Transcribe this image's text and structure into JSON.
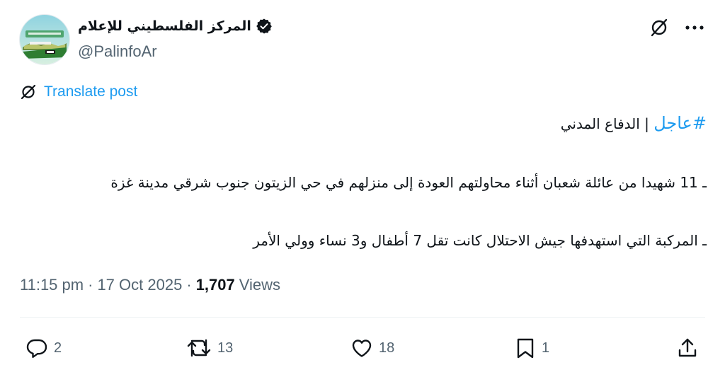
{
  "author": {
    "display_name": "المركز الفلسطيني للإعلام",
    "handle": "@PalinfoAr",
    "verified": true
  },
  "translate": {
    "label": "Translate post"
  },
  "post": {
    "hashtag": "#عاجل",
    "headline_rest": " | الدفاع المدني",
    "line2": "ـ 11 شهيدا من عائلة شعبان أثناء محاولتهم العودة إلى منزلهم في حي الزيتون جنوب شرقي مدينة غزة",
    "line3": "ـ المركبة التي استهدفها جيش الاحتلال كانت تقل 7 أطفال و3 نساء وولي الأمر"
  },
  "meta": {
    "time": "11:15 pm",
    "separator": "·",
    "date": "17 Oct 2025",
    "views_count": "1,707",
    "views_label": "Views"
  },
  "actions": {
    "replies": "2",
    "reposts": "13",
    "likes": "18",
    "bookmarks": "1"
  },
  "colors": {
    "accent": "#1d9bf0",
    "text": "#0f1419",
    "muted": "#536471"
  }
}
